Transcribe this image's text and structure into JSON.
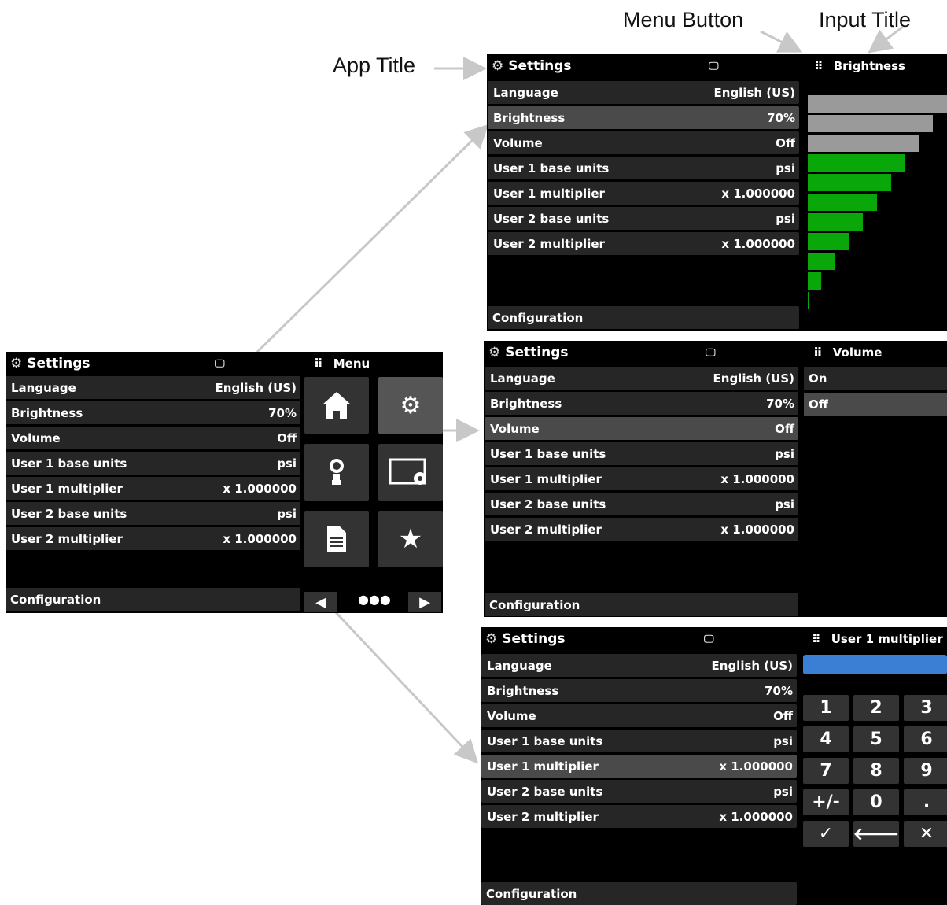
{
  "callouts": {
    "menu_button": "Menu Button",
    "input_title": "Input Title",
    "app_title": "App Title"
  },
  "app": {
    "title": "Settings",
    "status_icon": "display-connect-icon",
    "menu_label": "Menu",
    "footer": "Configuration",
    "rows": [
      {
        "label": "Language",
        "value": "English (US)"
      },
      {
        "label": "Brightness",
        "value": "70%"
      },
      {
        "label": "Volume",
        "value": "Off"
      },
      {
        "label": "User 1 base units",
        "value": "psi"
      },
      {
        "label": "User 1 multiplier",
        "value": "x 1.000000"
      },
      {
        "label": "User 2 base units",
        "value": "psi"
      },
      {
        "label": "User 2 multiplier",
        "value": "x 1.000000"
      }
    ]
  },
  "menu_tiles": [
    {
      "icon": "home-icon"
    },
    {
      "icon": "settings-gears-icon"
    },
    {
      "icon": "pressure-gauge-icon"
    },
    {
      "icon": "display-settings-icon"
    },
    {
      "icon": "document-icon"
    },
    {
      "icon": "star-icon"
    }
  ],
  "brightness_panel": {
    "title": "Brightness",
    "level_percent": 70,
    "bar_count": 11,
    "active_color": "#0aa70a",
    "inactive_color": "#9a9a9a"
  },
  "volume_panel": {
    "title": "Volume",
    "options": [
      "On",
      "Off"
    ],
    "selected": "Off"
  },
  "multiplier_panel": {
    "title": "User 1 multiplier",
    "input_value": "",
    "input_color": "#3b7fd4",
    "keys": [
      "1",
      "2",
      "3",
      "4",
      "5",
      "6",
      "7",
      "8",
      "9",
      "+/-",
      "0",
      ".",
      "✓",
      "🡐",
      "✕"
    ]
  }
}
